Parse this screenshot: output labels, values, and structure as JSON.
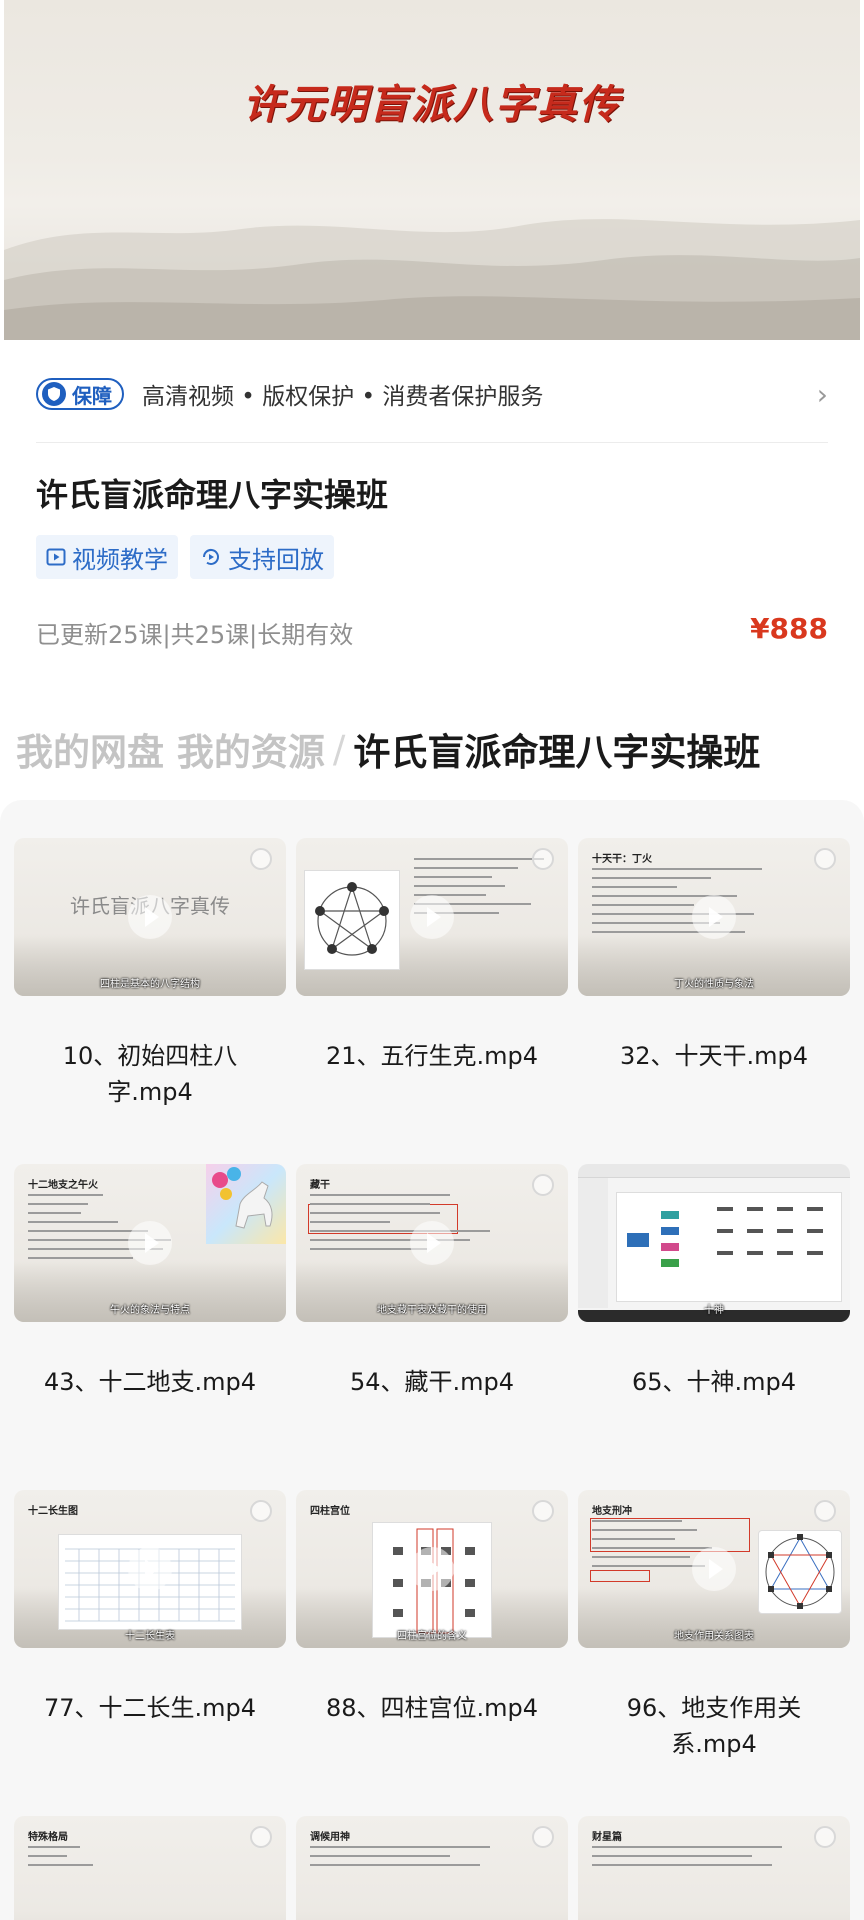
{
  "banner": {
    "title": "许元明盲派八字真传"
  },
  "guarantee": {
    "badge": "保障",
    "text": "高清视频 • 版权保护 • 消费者保护服务"
  },
  "course": {
    "title": "许氏盲派命理八字实操班",
    "tags": [
      "视频教学",
      "支持回放"
    ],
    "meta": "已更新25课|共25课|长期有效",
    "price": "¥888"
  },
  "breadcrumb": {
    "faded": "我的网盘 我的资源",
    "separator": "/",
    "current": "许氏盲派命理八字实操班"
  },
  "items": [
    {
      "label": "10、初始四柱八字.mp4",
      "slide_title": "许氏盲派八字真传",
      "caption": "四柱是基本的八字结构"
    },
    {
      "label": "21、五行生克.mp4",
      "slide_title": "",
      "caption": ""
    },
    {
      "label": "32、十天干.mp4",
      "slide_title": "十天干：丁火",
      "caption": "丁火的性质与象法"
    },
    {
      "label": "43、十二地支.mp4",
      "slide_title": "十二地支之午火",
      "caption": "午火的象法与特点"
    },
    {
      "label": "54、藏干.mp4",
      "slide_title": "藏干",
      "caption": "地支藏干表及藏干的使用"
    },
    {
      "label": "65、十神.mp4",
      "slide_title": "",
      "caption": "十神"
    },
    {
      "label": "77、十二长生.mp4",
      "slide_title": "十二长生图",
      "caption": "十二长生表"
    },
    {
      "label": "88、四柱宫位.mp4",
      "slide_title": "四柱宫位",
      "caption": "四柱宫位的含义"
    },
    {
      "label": "96、地支作用关系.mp4",
      "slide_title": "地支刑冲",
      "caption": "地支作用关系图表"
    },
    {
      "label": "",
      "slide_title": "特殊格局",
      "caption": ""
    },
    {
      "label": "",
      "slide_title": "调候用神",
      "caption": ""
    },
    {
      "label": "",
      "slide_title": "财星篇",
      "caption": ""
    }
  ],
  "colors": {
    "accent": "#1f5fbf",
    "price": "#d9381e",
    "banner_title": "#c62a1c"
  }
}
